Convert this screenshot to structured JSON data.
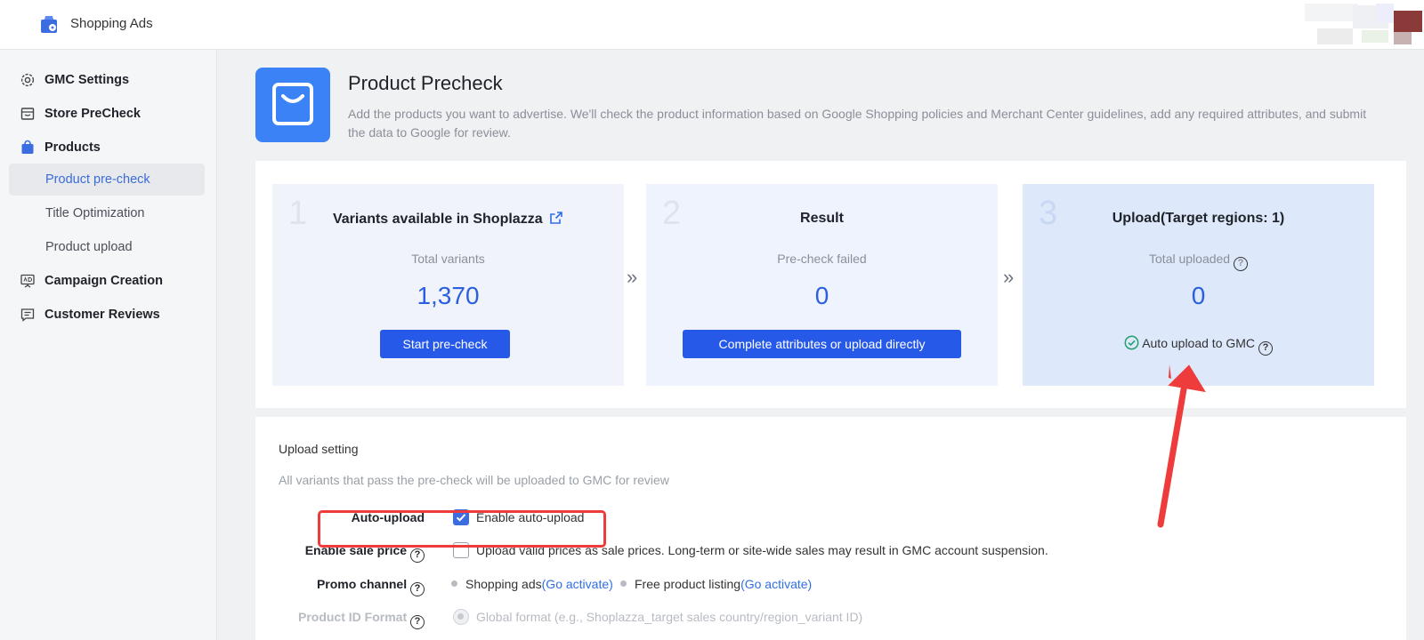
{
  "app": {
    "title": "Shopping Ads"
  },
  "sidebar": {
    "items": [
      {
        "label": "GMC Settings"
      },
      {
        "label": "Store PreCheck"
      },
      {
        "label": "Products"
      },
      {
        "label": "Product pre-check"
      },
      {
        "label": "Title Optimization"
      },
      {
        "label": "Product upload"
      },
      {
        "label": "Campaign Creation"
      },
      {
        "label": "Customer Reviews"
      }
    ]
  },
  "header": {
    "title": "Product Precheck",
    "description": "Add the products you want to advertise. We'll check the product information based on Google Shopping policies and Merchant Center guidelines, add any required attributes, and submit the data to Google for review."
  },
  "steps": [
    {
      "number": "1",
      "title": "Variants available in Shoplazza",
      "subtitle": "Total variants",
      "value": "1,370",
      "button": "Start pre-check"
    },
    {
      "number": "2",
      "title": "Result",
      "subtitle": "Pre-check failed",
      "value": "0",
      "button": "Complete attributes or upload directly"
    },
    {
      "number": "3",
      "title": "Upload(Target regions: 1)",
      "subtitle": "Total uploaded",
      "value": "0",
      "auto_text": "Auto upload to GMC"
    }
  ],
  "arrow_separator": "»",
  "help_glyph": "?",
  "settings": {
    "title": "Upload setting",
    "description": "All variants that pass the pre-check will be uploaded to GMC for review",
    "auto_upload": {
      "label": "Auto-upload",
      "option": "Enable auto-upload",
      "checked": true
    },
    "sale_price": {
      "label": "Enable sale price",
      "option": "Upload valid prices as sale prices. Long-term or site-wide sales may result in GMC account suspension.",
      "checked": false
    },
    "promo_channel": {
      "label": "Promo channel",
      "channels": [
        {
          "name": "Shopping ads",
          "link": "(Go activate)"
        },
        {
          "name": "Free product listing",
          "link": "(Go activate)"
        }
      ]
    },
    "product_id_format": {
      "label": "Product ID Format",
      "option": "Global format (e.g., Shoplazza_target sales country/region_variant ID)"
    }
  },
  "colors": {
    "primary": "#2759e8",
    "accent_text": "#2b5fe0",
    "annotation": "#ee3b3b",
    "success": "#22a06b"
  }
}
